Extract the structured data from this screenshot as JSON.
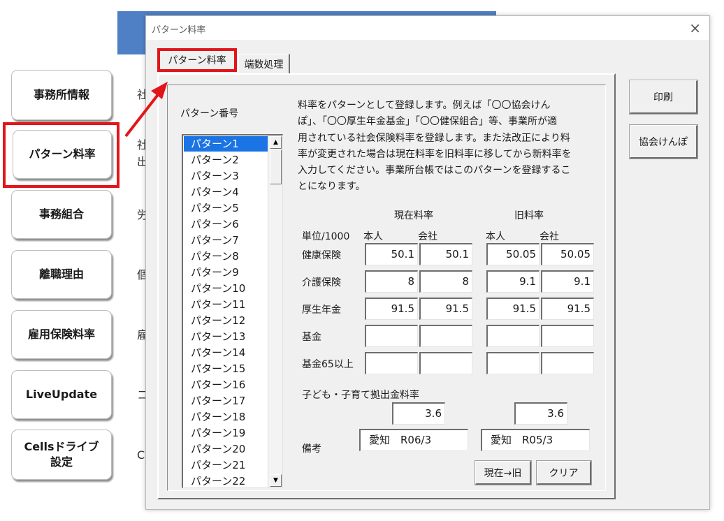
{
  "background": {
    "side_buttons": [
      "事務所情報",
      "パターン料率",
      "事務組合",
      "離職理由",
      "雇用保険料率",
      "LiveUpdate",
      "Cellsドライブ\n設定"
    ],
    "behind_texts": [
      "社",
      "社\n出",
      "労",
      "個",
      "雇",
      "コ",
      "C"
    ]
  },
  "dialog": {
    "title": "パターン料率",
    "close_glyph": "×",
    "tabs": [
      "パターン料率",
      "端数処理"
    ],
    "pattern_label": "パターン番号",
    "patterns": [
      "パターン1",
      "パターン2",
      "パターン3",
      "パターン4",
      "パターン5",
      "パターン6",
      "パターン7",
      "パターン8",
      "パターン9",
      "パターン10",
      "パターン11",
      "パターン12",
      "パターン13",
      "パターン14",
      "パターン15",
      "パターン16",
      "パターン17",
      "パターン18",
      "パターン19",
      "パターン20",
      "パターン21",
      "パターン22"
    ],
    "description": "料率をパターンとして登録します。例えば「〇〇協会けん\nぽ」、「〇〇厚生年金基金」「〇〇健保組合」等、事業所が適\n用されている社会保険料率を登録します。また法改正により料\n率が変更された場合は現在料率を旧料率に移してから新料率を\n入力してください。事業所台帳ではこのパターンを登録するこ\nとになります。",
    "current_header": "現在料率",
    "old_header": "旧料率",
    "unit_label": "単位/1000",
    "person_label": "本人",
    "company_label": "会社",
    "rows": [
      {
        "label": "健康保険",
        "cur_person": "50.1",
        "cur_company": "50.1",
        "old_person": "50.05",
        "old_company": "50.05"
      },
      {
        "label": "介護保険",
        "cur_person": "8",
        "cur_company": "8",
        "old_person": "9.1",
        "old_company": "9.1"
      },
      {
        "label": "厚生年金",
        "cur_person": "91.5",
        "cur_company": "91.5",
        "old_person": "91.5",
        "old_company": "91.5"
      },
      {
        "label": "基金",
        "cur_person": "",
        "cur_company": "",
        "old_person": "",
        "old_company": ""
      },
      {
        "label": "基金65以上",
        "cur_person": "",
        "cur_company": "",
        "old_person": "",
        "old_company": ""
      }
    ],
    "child_label": "子ども・子育て拠出金料率",
    "child_current": "3.6",
    "child_old": "3.6",
    "remarks_label": "備考",
    "remarks_current": "愛知　R06/3",
    "remarks_old": "愛知　R05/3",
    "move_button": "現在→旧",
    "clear_button": "クリア",
    "print_button": "印刷",
    "kyokai_button": "協会けんぽ"
  },
  "colors": {
    "highlight": "#e2151b",
    "selection": "#1b74e4",
    "banner": "#4f80c6"
  }
}
